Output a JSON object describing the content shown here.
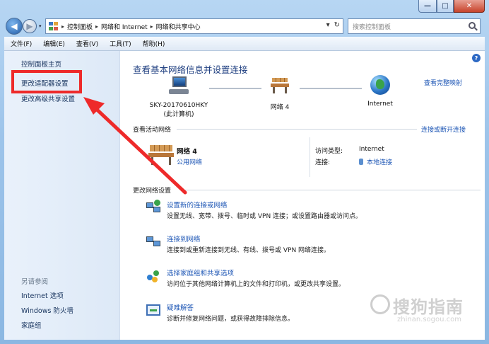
{
  "window": {
    "min_icon": "—",
    "max_icon": "□",
    "close_icon": "✕"
  },
  "address": {
    "back_icon": "◀",
    "forward_icon": "▶",
    "history_icon": "▾",
    "crumbs": [
      "控制面板",
      "网络和 Internet",
      "网络和共享中心"
    ],
    "sep": "▸",
    "dropdown_icon": "▾",
    "refresh_icon": "↻"
  },
  "search": {
    "placeholder": "搜索控制面板"
  },
  "menu": [
    "文件(F)",
    "编辑(E)",
    "查看(V)",
    "工具(T)",
    "帮助(H)"
  ],
  "left": {
    "home": "控制面板主页",
    "links": [
      "更改适配器设置",
      "更改高级共享设置"
    ],
    "see_also_label": "另请参阅",
    "see_also": [
      "Internet 选项",
      "Windows 防火墙",
      "家庭组"
    ]
  },
  "main": {
    "help_icon": "?",
    "title": "查看基本网络信息并设置连接",
    "full_map": "查看完整映射",
    "nodes": [
      {
        "line1": "SKY-20170610HKY",
        "line2": "(此计算机)"
      },
      {
        "line1": "网络  4"
      },
      {
        "line1": "Internet"
      }
    ],
    "active_label": "查看活动网络",
    "disconnect": "连接或断开连接",
    "active": {
      "name": "网络  4",
      "type": "公用网络",
      "access_key": "访问类型:",
      "access_val": "Internet",
      "conn_key": "连接:",
      "conn_val": "本地连接"
    },
    "change_label": "更改网络设置",
    "tasks": [
      {
        "title": "设置新的连接或网络",
        "desc": "设置无线、宽带、拨号、临时或 VPN 连接；或设置路由器或访问点。"
      },
      {
        "title": "连接到网络",
        "desc": "连接到或重新连接到无线、有线、拨号或 VPN 网络连接。"
      },
      {
        "title": "选择家庭组和共享选项",
        "desc": "访问位于其他网络计算机上的文件和打印机，或更改共享设置。"
      },
      {
        "title": "疑难解答",
        "desc": "诊断并修复网络问题，或获得故障排除信息。"
      }
    ]
  },
  "watermark": {
    "text": "搜狗指南",
    "sub": "zhinan.sogou.com"
  },
  "colors": {
    "annotation": "#ee2a2a",
    "link": "#1d56b5",
    "title": "#1f3f80"
  }
}
